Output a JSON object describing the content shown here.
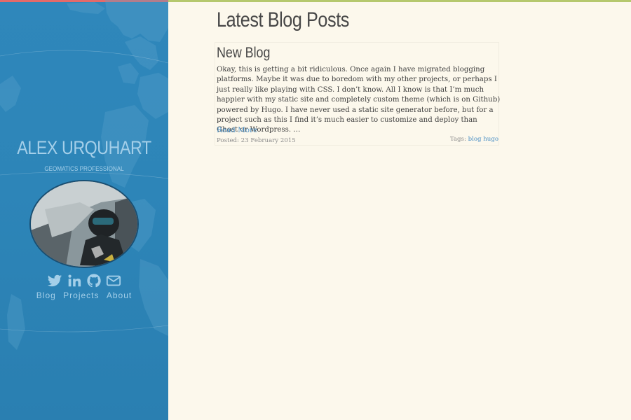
{
  "sidebar": {
    "author_name": "ALEX URQUHART",
    "author_role": "GEOMATICS PROFESSIONAL",
    "social_icons": [
      "twitter-icon",
      "linkedin-icon",
      "github-icon",
      "email-icon"
    ],
    "nav": [
      "Blog",
      "Projects",
      "About"
    ]
  },
  "main": {
    "page_title": "Latest Blog Posts",
    "posts": [
      {
        "title": "New Blog",
        "summary": "Okay, this is getting a bit ridiculous. Once again I have migrated blogging platforms. Maybe it was due to boredom with my other projects, or perhaps I just really like playing with CSS. I don’t know. All I know is that I’m much happier with my static site and completely custom theme (which is on Github) powered by Hugo. I have never used a static site generator before, but for a project such as this I find it’s much easier to customize and deploy than Ghost or Wordpress. …",
        "read_more": "Read More",
        "posted": "Posted: 23 February 2015",
        "tags_label": "Tags:",
        "tags": [
          "blog",
          "hugo"
        ]
      }
    ]
  },
  "colors": {
    "sidebar_bg": "#2d85b8",
    "sidebar_text": "#a4cfe9",
    "page_bg": "#fcf8ec",
    "link": "#4a8fc5",
    "sidebar_accent": "#e46a6a",
    "main_accent": "#b5c86d"
  }
}
